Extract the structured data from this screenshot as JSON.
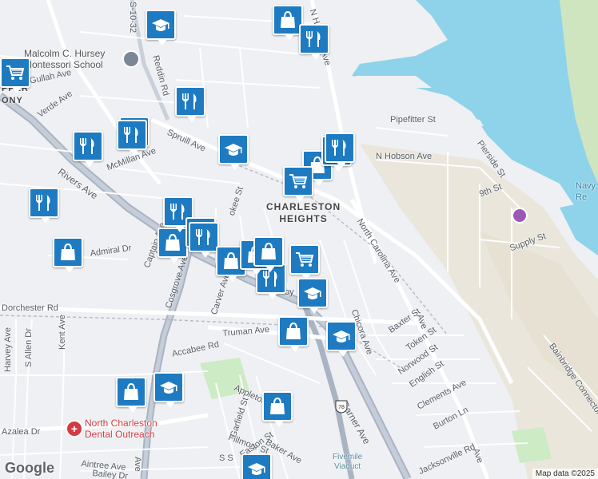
{
  "map": {
    "attribution": "Map data ©2025",
    "logo": "Google",
    "place_labels": [
      {
        "id": "charleston-heights",
        "text": "CHARLESTON\nHEIGHTS"
      },
      {
        "id": "upper-colony",
        "text": "PPER\nONY"
      },
      {
        "id": "navy",
        "text": "Navy\nRe"
      }
    ],
    "poi_labels": [
      {
        "id": "hursey-school",
        "text": "Malcolm C. Hursey\nMontessori School"
      },
      {
        "id": "dental-outreach",
        "text": "North Charleston\nDental Outreach"
      },
      {
        "id": "fivemile-viaduct",
        "text": "Fivemile\nViaduct"
      }
    ],
    "street_labels": [
      "S-10-32",
      "Reddin Rd",
      "Gullah Ave",
      "Verde Ave",
      "Spruill Ave",
      "McMillan Ave",
      "Rivers Ave",
      "Dorchester Rd",
      "Admiral Dr",
      "Commander",
      "Captain Ave",
      "Cosgrove Ave",
      "Carver Ave",
      "Truman Ave",
      "Accabee Rd",
      "Kent Ave",
      "S Allen Dr",
      "Harvey Ave",
      "Azalea Dr",
      "Aintree Ave",
      "Bailey Dr",
      "Garfield St",
      "Fillmore St",
      "Easton St",
      "Baker Ave",
      "Appleton",
      "Carner Ave",
      "Chicora Ave",
      "North Carolina Ave",
      "Baxter St",
      "Token St",
      "Norwood St",
      "English St",
      "Clements Ave",
      "Burton Ln",
      "Jacksonville Rd",
      "Bainbridge Connector",
      "Pipefitter St",
      "N Hobson Ave",
      "Pierside St",
      "9th St",
      "Supply St",
      "N H",
      "Ave",
      "okee St",
      "oy",
      "S S",
      "Ave",
      "Ave",
      "Ave"
    ],
    "route_shield": "78",
    "markers": [
      {
        "type": "school"
      },
      {
        "type": "shopping"
      },
      {
        "type": "restaurant"
      },
      {
        "type": "grocery"
      },
      {
        "type": "restaurant"
      },
      {
        "type": "restaurant"
      },
      {
        "type": "restaurant"
      },
      {
        "type": "school"
      },
      {
        "type": "restaurant"
      },
      {
        "type": "shopping"
      },
      {
        "type": "grocery"
      },
      {
        "type": "restaurant"
      },
      {
        "type": "restaurant"
      },
      {
        "type": "restaurant"
      },
      {
        "type": "shopping"
      },
      {
        "type": "shopping"
      },
      {
        "type": "restaurant"
      },
      {
        "type": "restaurant"
      },
      {
        "type": "restaurant"
      },
      {
        "type": "grocery"
      },
      {
        "type": "school"
      },
      {
        "type": "restaurant"
      },
      {
        "type": "shopping"
      },
      {
        "type": "shopping"
      },
      {
        "type": "shopping"
      },
      {
        "type": "school"
      },
      {
        "type": "shopping"
      },
      {
        "type": "school"
      },
      {
        "type": "shopping"
      },
      {
        "type": "school"
      },
      {
        "type": "shopping"
      }
    ]
  }
}
